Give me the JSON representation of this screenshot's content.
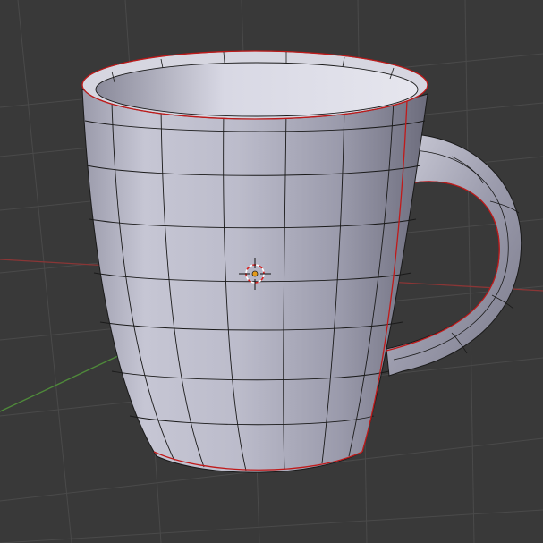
{
  "viewport": {
    "mode": "edit-mode-wireframe-overlay",
    "object": "mug-mesh",
    "colors": {
      "background": "#393939",
      "grid": "#4a4a4a",
      "x_axis": "#8a3636",
      "y_axis": "#4f8a3a",
      "mesh_fill_light": "#c9c9d8",
      "mesh_fill_dark": "#6f6f7f",
      "edge": "#1a1a1a",
      "seam": "#c01a1a",
      "cursor_ring_white": "#ffffff",
      "cursor_ring_red": "#d92020",
      "origin": "#e39a1a"
    },
    "icons": [
      "3d-cursor-icon",
      "object-origin-icon"
    ]
  }
}
